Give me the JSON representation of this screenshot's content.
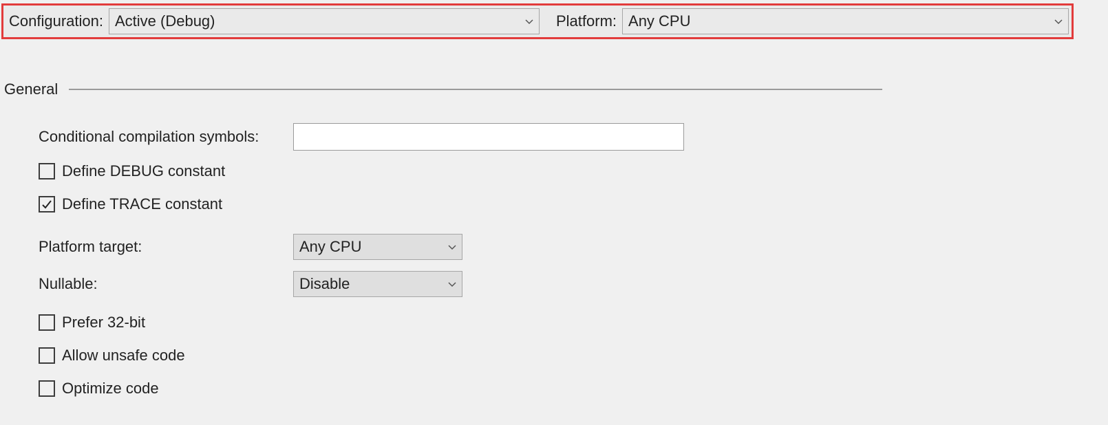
{
  "topbar": {
    "configuration_label": "Configuration:",
    "configuration_value": "Active (Debug)",
    "platform_label": "Platform:",
    "platform_value": "Any CPU"
  },
  "section": {
    "title": "General"
  },
  "fields": {
    "conditional_symbols_label": "Conditional compilation symbols:",
    "conditional_symbols_value": "",
    "define_debug_label": "Define DEBUG constant",
    "define_debug_checked": false,
    "define_trace_label": "Define TRACE constant",
    "define_trace_checked": true,
    "platform_target_label": "Platform target:",
    "platform_target_value": "Any CPU",
    "nullable_label": "Nullable:",
    "nullable_value": "Disable",
    "prefer32_label": "Prefer 32-bit",
    "prefer32_checked": false,
    "allow_unsafe_label": "Allow unsafe code",
    "allow_unsafe_checked": false,
    "optimize_label": "Optimize code",
    "optimize_checked": false
  }
}
